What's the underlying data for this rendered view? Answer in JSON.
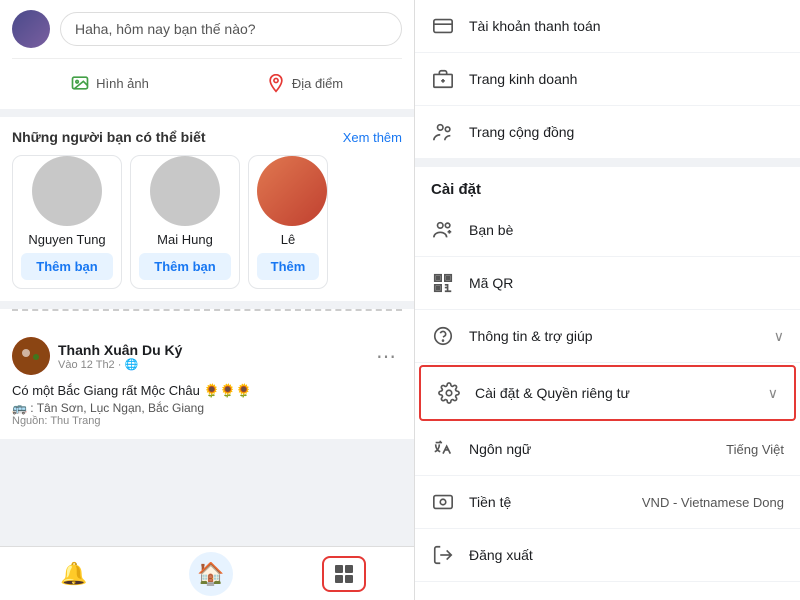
{
  "left": {
    "post_placeholder": "Haha, hôm nay bạn thế nào?",
    "photo_label": "Hình ảnh",
    "location_label": "Địa điểm",
    "suggestions": {
      "title": "Những người bạn có thể biết",
      "see_more": "Xem thêm",
      "friends": [
        {
          "name": "Nguyen Tung",
          "btn": "Thêm bạn"
        },
        {
          "name": "Mai Hung",
          "btn": "Thêm bạn"
        },
        {
          "name": "Lê",
          "btn": "Thê"
        }
      ]
    },
    "post": {
      "author": "Thanh Xuân Du Ký",
      "meta": "Vào 12 Th2 · 🌐",
      "text": "Có một Bắc Giang rất Mộc Châu 🌻🌻🌻",
      "subtext": "🚌 : Tân Sơn, Lục Ngạn, Bắc Giang",
      "credit": "Nguồn: Thu Trang"
    }
  },
  "right": {
    "top_items": [
      {
        "icon": "💳",
        "label": "Tài khoản thanh toán"
      },
      {
        "icon": "💼",
        "label": "Trang kinh doanh"
      },
      {
        "icon": "👥",
        "label": "Trang cộng đồng"
      }
    ],
    "settings_header": "Cài đặt",
    "settings_items": [
      {
        "icon": "👤",
        "label": "Bạn bè",
        "value": "",
        "chevron": false,
        "highlighted": false
      },
      {
        "icon": "QR",
        "label": "Mã QR",
        "value": "",
        "chevron": false,
        "highlighted": false
      },
      {
        "icon": "?",
        "label": "Thông tin & trợ giúp",
        "value": "",
        "chevron": true,
        "highlighted": false
      },
      {
        "icon": "⚙️",
        "label": "Cài đặt & Quyền riêng tư",
        "value": "",
        "chevron": true,
        "highlighted": true
      },
      {
        "icon": "XA",
        "label": "Ngôn ngữ",
        "value": "Tiếng Việt",
        "chevron": false,
        "highlighted": false
      },
      {
        "icon": "$",
        "label": "Tiền tệ",
        "value": "VND - Vietnamese Dong",
        "chevron": false,
        "highlighted": false
      },
      {
        "icon": "→",
        "label": "Đăng xuất",
        "value": "",
        "chevron": false,
        "highlighted": false
      }
    ]
  }
}
